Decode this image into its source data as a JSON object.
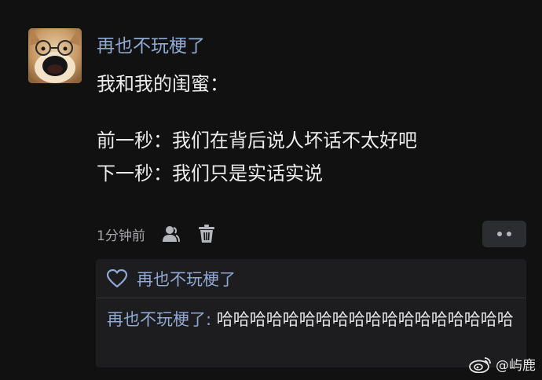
{
  "post": {
    "username": "再也不玩梗了",
    "lines": [
      "我和我的闺蜜：",
      "",
      "前一秒：我们在背后说人坏话不太好吧",
      "下一秒：我们只是实话实说"
    ],
    "timestamp": "1分钟前",
    "icons": {
      "profile": "user-icon",
      "delete": "trash-icon",
      "more": "more-icon"
    }
  },
  "reply_box": {
    "liked_by": "再也不玩梗了",
    "reply_author": "再也不玩梗了:",
    "reply_content": " 哈哈哈哈哈哈哈哈哈哈哈哈哈哈哈哈哈哈",
    "icons": {
      "like": "heart-icon"
    }
  },
  "watermark": {
    "text": "@屿鹿",
    "icon": "weibo-icon"
  },
  "colors": {
    "background": "#111112",
    "link_blue": "#8fa9d4",
    "reply_bg": "#1d1d1f"
  }
}
